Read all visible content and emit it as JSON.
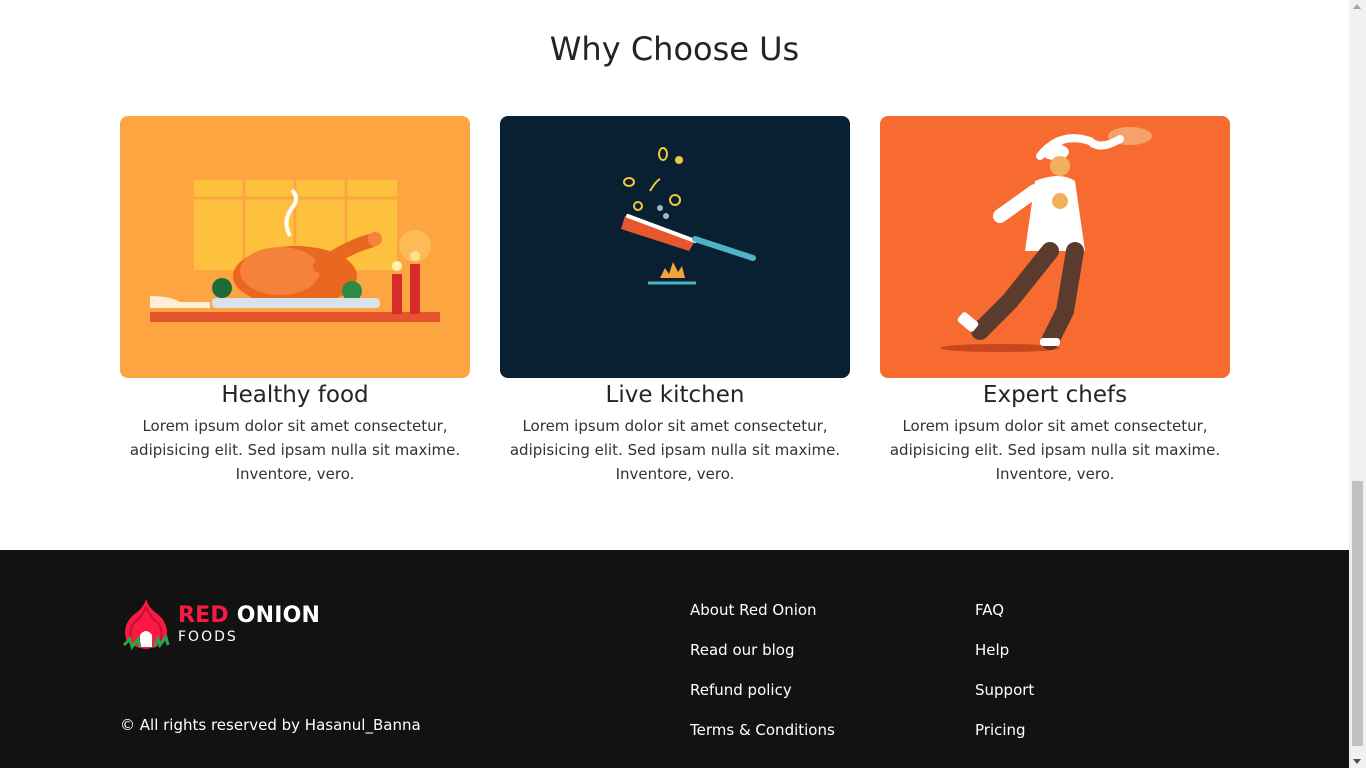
{
  "section": {
    "title": "Why Choose Us"
  },
  "cards": [
    {
      "title": "Healthy food",
      "text": "Lorem ipsum dolor sit amet consectetur, adipisicing elit. Sed ipsam nulla sit maxime. Inventore, vero.",
      "image_icon": "roast-turkey-illustration",
      "bg": "#fda541"
    },
    {
      "title": "Live kitchen",
      "text": "Lorem ipsum dolor sit amet consectetur, adipisicing elit. Sed ipsam nulla sit maxime. Inventore, vero.",
      "image_icon": "frying-pan-illustration",
      "bg": "#082031"
    },
    {
      "title": "Expert chefs",
      "text": "Lorem ipsum dolor sit amet consectetur, adipisicing elit. Sed ipsam nulla sit maxime. Inventore, vero.",
      "image_icon": "chef-illustration",
      "bg": "#f76b30"
    }
  ],
  "footer": {
    "logo": {
      "brand_red": "RED",
      "brand_white": "ONION",
      "sub": "FOODS",
      "icon": "onion-icon"
    },
    "copyright": "© All rights reserved by Hasanul_Banna",
    "links_col1": [
      "About Red Onion",
      "Read our blog",
      "Refund policy",
      "Terms & Conditions"
    ],
    "links_col2": [
      "FAQ",
      "Help",
      "Support",
      "Pricing"
    ]
  },
  "colors": {
    "accent": "#f91944",
    "footer_bg": "#121212"
  }
}
